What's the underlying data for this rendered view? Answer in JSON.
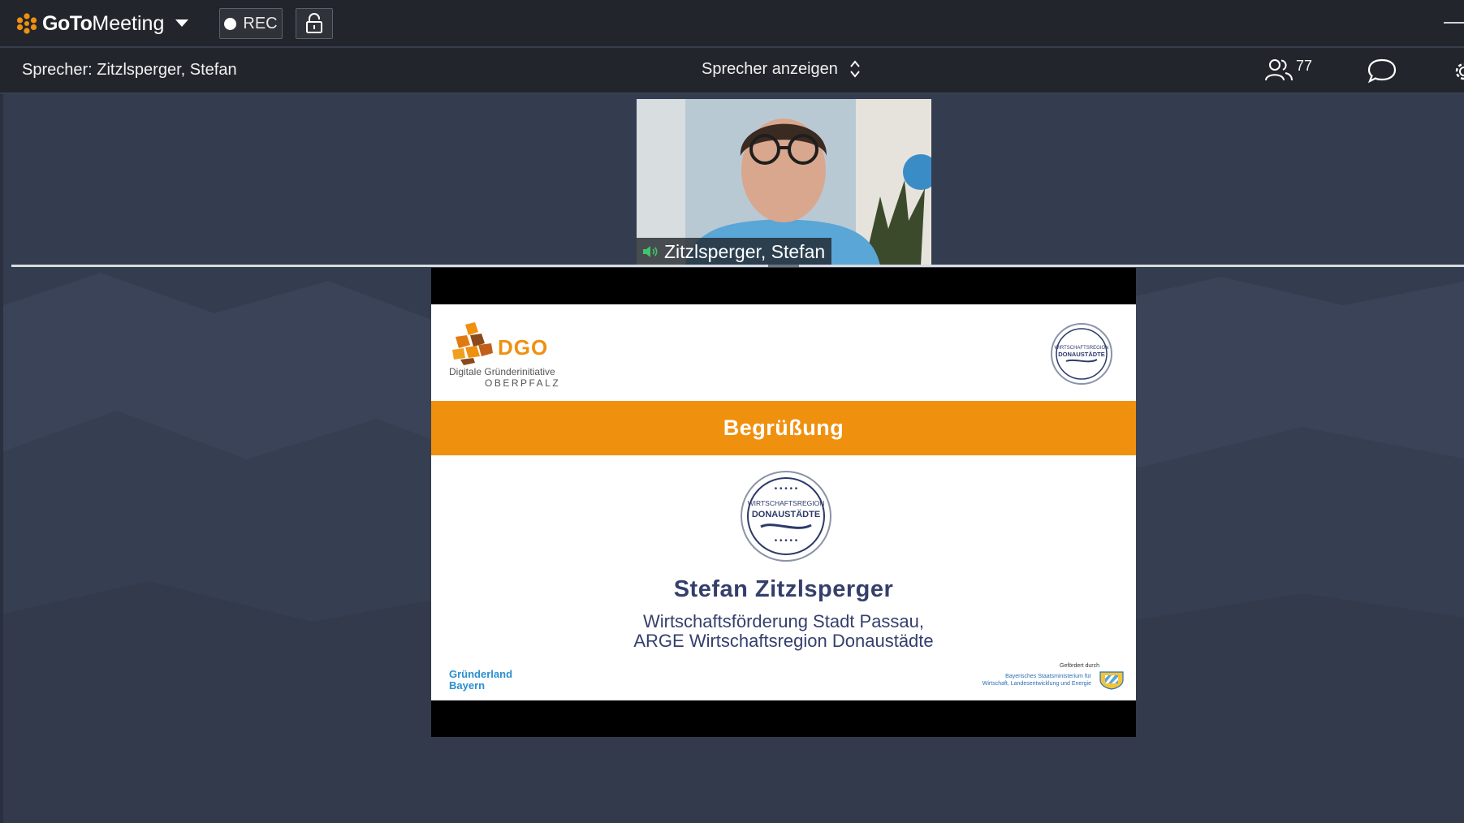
{
  "titlebar": {
    "brand_part1": "GoTo",
    "brand_part2": "Meeting",
    "rec_label": "REC"
  },
  "toolbar": {
    "speaker_label": "Sprecher: Zitzlsperger, Stefan",
    "view_mode": "Sprecher anzeigen",
    "participant_count": "77"
  },
  "webcam": {
    "name": "Zitzlsperger, Stefan"
  },
  "slide": {
    "dgo_logo_text": "DGO",
    "dgo_subtitle_line1": "Digitale Gründerinitiative",
    "dgo_subtitle_line2": "OBERPFALZ",
    "seal_text": "WIRTSCHAFTSREGION",
    "seal_text2": "DONAUSTÄDTE",
    "banner_title": "Begrüßung",
    "speaker_name": "Stefan Zitzlsperger",
    "org_line1": "Wirtschaftsförderung Stadt Passau,",
    "org_line2": "ARGE Wirtschaftsregion Donaustädte",
    "gruenderland_line1": "Gründerland",
    "gruenderland_line2": "Bayern",
    "funded_by": "Gefördert durch",
    "ministry_line1": "Bayerisches Staatsministerium für",
    "ministry_line2": "Wirtschaft, Landesentwicklung und Energie"
  },
  "colors": {
    "brand_orange": "#f0900f",
    "toolbar_bg": "#22262c",
    "stage_bg": "#343c4f",
    "slide_navy": "#353f6b"
  }
}
